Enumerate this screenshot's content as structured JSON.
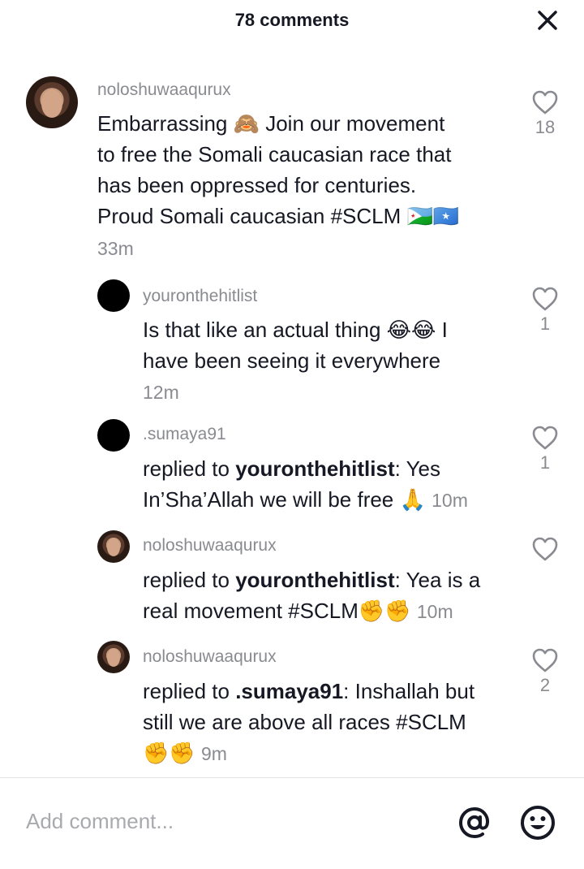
{
  "header": {
    "title": "78 comments"
  },
  "comments": [
    {
      "username": "noloshuwaaqurux",
      "line1": "Embarrassing 🙈 Join our movement",
      "line2": "to free the Somali caucasian race that",
      "line3": "has been oppressed for centuries.",
      "line4": "Proud Somali caucasian #SCLM 🇩🇯🇸🇴",
      "time": "33m",
      "likes": "18"
    },
    {
      "username": "youronthehitlist",
      "line1": "Is that like an actual thing 😂😂 I",
      "line2": "have been seeing it everywhere",
      "time": "12m",
      "likes": "1"
    },
    {
      "username": ".sumaya91",
      "prefix": "replied to ",
      "mention": "youronthehitlist",
      "after": ": Yes",
      "line2": "In’Sha’Allah we will be free 🙏",
      "time": "10m",
      "likes": "1"
    },
    {
      "username": "noloshuwaaqurux",
      "prefix": "replied to ",
      "mention": "youronthehitlist",
      "after": ": Yea is a",
      "line2": "real movement #SCLM✊✊",
      "time": "10m",
      "likes": ""
    },
    {
      "username": "noloshuwaaqurux",
      "prefix": "replied to ",
      "mention": ".sumaya91",
      "after": ": Inshallah but",
      "line2": "still we are above all races #SCLM",
      "line3": "✊✊",
      "time": "9m",
      "likes": "2"
    }
  ],
  "composer": {
    "placeholder": "Add comment..."
  },
  "icons": {
    "close": "close-icon",
    "heart": "heart-icon",
    "at": "at-icon",
    "emoji": "emoji-icon"
  },
  "colors": {
    "text": "#161823",
    "muted": "#8a8b91"
  }
}
